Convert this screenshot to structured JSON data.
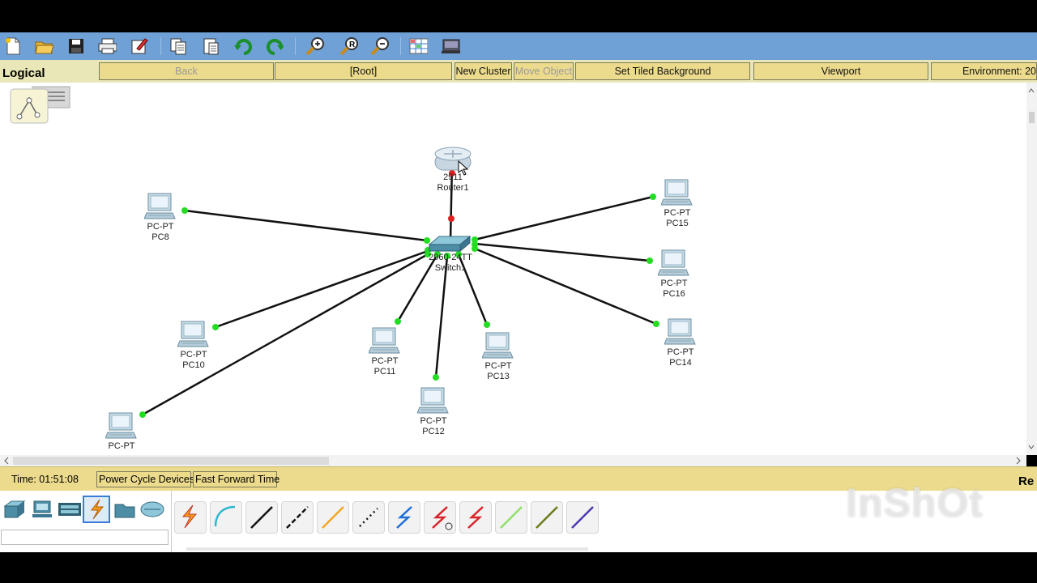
{
  "toolbar": {
    "icons": [
      "new-file-icon",
      "open-folder-icon",
      "save-icon",
      "print-icon",
      "activity-wizard-icon",
      "copy-icon",
      "paste-icon",
      "undo-icon",
      "redo-icon",
      "zoom-in-icon",
      "zoom-reset-icon",
      "zoom-out-icon",
      "palette-icon",
      "custom-device-icon"
    ]
  },
  "logical_bar": {
    "label": "Logical",
    "back": "Back",
    "root": "[Root]",
    "new_cluster": "New Cluster",
    "move_object": "Move Object",
    "set_tiled_background": "Set Tiled Background",
    "viewport": "Viewport",
    "environment": "Environment: 20"
  },
  "devices": {
    "router": {
      "model": "2911",
      "name": "Router1"
    },
    "switch": {
      "model": "2960-24TT",
      "name": "Switch1"
    },
    "pcs": [
      {
        "model": "PC-PT",
        "name": "PC8"
      },
      {
        "model": "PC-PT",
        "name": "PC15"
      },
      {
        "model": "PC-PT",
        "name": "PC16"
      },
      {
        "model": "PC-PT",
        "name": "PC10"
      },
      {
        "model": "PC-PT",
        "name": "PC11"
      },
      {
        "model": "PC-PT",
        "name": "PC13"
      },
      {
        "model": "PC-PT",
        "name": "PC14"
      },
      {
        "model": "PC-PT",
        "name": "PC12"
      },
      {
        "model": "PC-PT",
        "name": ""
      }
    ]
  },
  "status_bar": {
    "time": "Time: 01:51:08",
    "power_cycle": "Power Cycle Devices",
    "fast_forward": "Fast Forward Time",
    "realtime_partial": "Re"
  },
  "device_categories": [
    "network-devices-icon",
    "end-devices-icon",
    "components-icon",
    "connections-icon",
    "miscellaneous-icon",
    "multiuser-icon"
  ],
  "connection_types": [
    "automatic-connection-icon",
    "console-cable-icon",
    "copper-straight-through-icon",
    "copper-cross-over-icon",
    "fiber-icon",
    "phone-cable-icon",
    "coaxial-cable-icon",
    "serial-dce-icon",
    "serial-dte-icon",
    "octal-cable-icon",
    "iot-custom-cable-icon",
    "usb-cable-icon"
  ],
  "watermark": "InShOt",
  "colors": {
    "toolbar": "#6fa0d6",
    "nav_button": "#ecdb8c",
    "link_up": "#22dd22",
    "link_down": "#e02020"
  }
}
